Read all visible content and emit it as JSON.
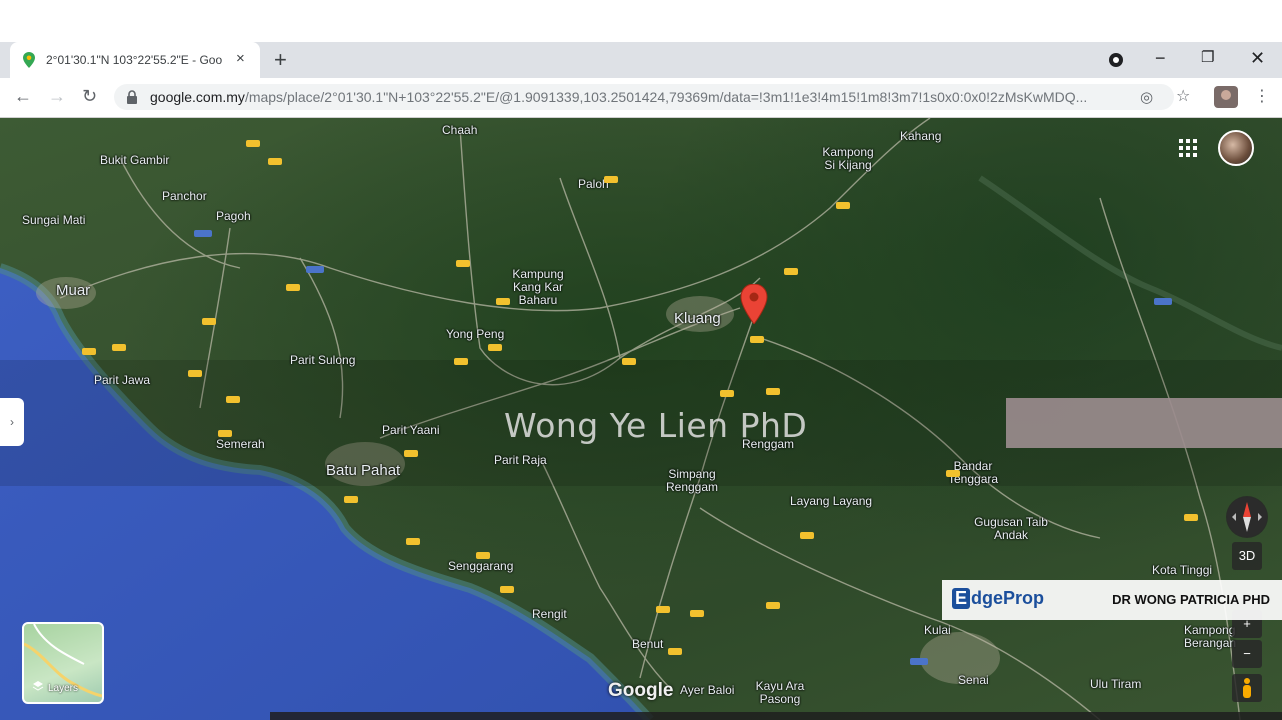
{
  "browser": {
    "tab_title": "2°01'30.1\"N 103°22'55.2\"E - Goo",
    "tab_close": "×",
    "new_tab": "+",
    "url_host": "google.com.my",
    "url_path": "/maps/place/2°01'30.1\"N+103°22'55.2\"E/@1.9091339,103.2501424,79369m/data=!3m1!1e3!4m15!1m8!3m7!1s0x0:0x0!2zMsKwMDQ...",
    "controls": {
      "minimize": "−",
      "maximize": "❐",
      "close": "✕"
    },
    "nav": {
      "back": "←",
      "forward": "→",
      "reload": "↻"
    }
  },
  "map": {
    "watermark": "Wong Ye Lien PhD",
    "google_logo": "Google",
    "layers_label": "Layers",
    "ctl_3d": "3D",
    "ctl_plus": "+",
    "ctl_minus": "−",
    "places": [
      {
        "name": "Chaah"
      },
      {
        "name": "Kahang"
      },
      {
        "name": "Bukit Gambir"
      },
      {
        "name": "Kampong Si Kijang"
      },
      {
        "name": "Paloh"
      },
      {
        "name": "Panchor"
      },
      {
        "name": "Pagoh"
      },
      {
        "name": "Sungai Mati"
      },
      {
        "name": "Kampung Kang Kar Baharu"
      },
      {
        "name": "Muar"
      },
      {
        "name": "Kluang"
      },
      {
        "name": "Yong Peng"
      },
      {
        "name": "Parit Sulong"
      },
      {
        "name": "Parit Jawa"
      },
      {
        "name": "Parit Yaani"
      },
      {
        "name": "Semerah"
      },
      {
        "name": "Batu Pahat"
      },
      {
        "name": "Renggam"
      },
      {
        "name": "Simpang Renggam"
      },
      {
        "name": "Parit Raja"
      },
      {
        "name": "Layang Layang"
      },
      {
        "name": "Bandar Tenggara"
      },
      {
        "name": "Gugusan Taib Andak"
      },
      {
        "name": "Senggarang"
      },
      {
        "name": "Rengit"
      },
      {
        "name": "Benut"
      },
      {
        "name": "Ayer Baloi"
      },
      {
        "name": "Kayu Ara Pasong"
      },
      {
        "name": "Kulai"
      },
      {
        "name": "Senai"
      },
      {
        "name": "Ulu Tiram"
      },
      {
        "name": "Kota Tinggi"
      },
      {
        "name": "Kampong Berangan"
      }
    ]
  },
  "overlay": {
    "edgeprop_logo_e": "E",
    "edgeprop_logo_rest": "dgeProp",
    "edgeprop_author": "DR WONG PATRICIA PHD"
  }
}
